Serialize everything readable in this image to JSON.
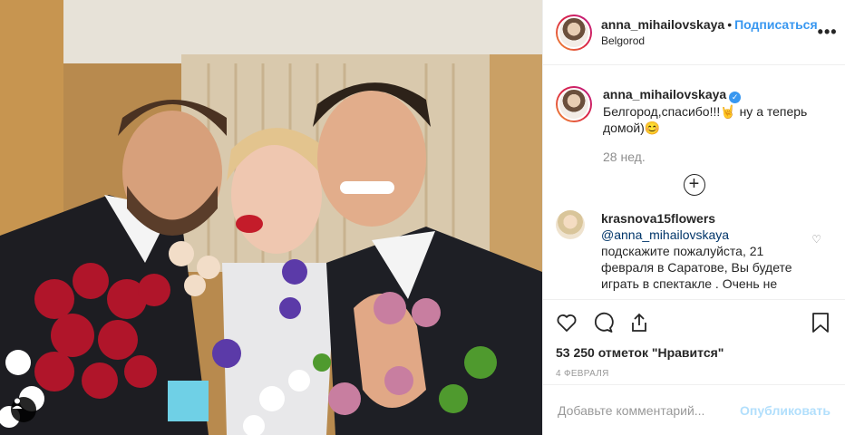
{
  "post": {
    "username": "anna_mihailovskaya",
    "follow_label": "Подписаться",
    "location": "Belgorod",
    "more_label": "•••"
  },
  "caption": {
    "username": "anna_mihailovskaya",
    "text": "Белгород,спасибо!!!🤘 ну а теперь домой)😊",
    "time": "28 нед."
  },
  "comments": [
    {
      "username": "krasnova15flowers",
      "mention": "@anna_mihailovskaya",
      "text": "подскажите пожалуйста, 21 февраля в Саратове, Вы будете играть в спектакле . Очень не"
    }
  ],
  "stats": {
    "likes": "53 250 отметок \"Нравится\"",
    "date": "4 ФЕВРАЛЯ"
  },
  "comment_box": {
    "placeholder": "Добавьте комментарий...",
    "publish_label": "Опубликовать"
  },
  "colors": {
    "accent": "#3897f0",
    "publish_disabled": "#b2dffc"
  }
}
